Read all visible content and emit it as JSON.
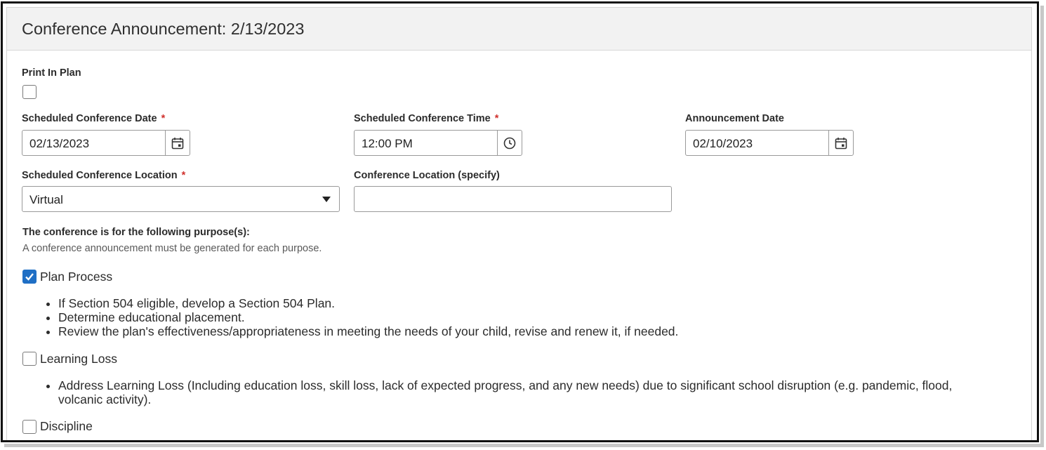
{
  "panel": {
    "title": "Conference Announcement: 2/13/2023"
  },
  "print_in_plan": {
    "label": "Print In Plan",
    "checked": false
  },
  "fields": {
    "conference_date": {
      "label": "Scheduled Conference Date",
      "required_mark": "*",
      "value": "02/13/2023",
      "button_icon": "calendar-icon"
    },
    "conference_time": {
      "label": "Scheduled Conference Time",
      "required_mark": "*",
      "value": "12:00 PM",
      "button_icon": "clock-icon"
    },
    "announcement_date": {
      "label": "Announcement Date",
      "value": "02/10/2023",
      "button_icon": "calendar-icon"
    },
    "conference_location": {
      "label": "Scheduled Conference Location",
      "required_mark": "*",
      "value": "Virtual",
      "button_icon": "dropdown-arrow-icon"
    },
    "location_specify": {
      "label": "Conference Location (specify)",
      "value": ""
    }
  },
  "purposes": {
    "heading": "The conference is for the following purpose(s):",
    "hint": "A conference announcement must be generated for each purpose.",
    "items": [
      {
        "label": "Plan Process",
        "checked": true,
        "bullets": [
          "If Section 504 eligible, develop a Section 504 Plan.",
          "Determine educational placement.",
          "Review the plan's effectiveness/appropriateness in meeting the needs of your child, revise and renew it, if needed."
        ]
      },
      {
        "label": "Learning Loss",
        "checked": false,
        "bullets": [
          "Address Learning Loss (Including education loss, skill loss, lack of expected progress, and any new needs) due to significant school disruption (e.g. pandemic, flood, volcanic activity)."
        ]
      },
      {
        "label": "Discipline",
        "checked": false,
        "bullets": []
      }
    ]
  },
  "colors": {
    "accent": "#1f6fc5",
    "required": "#d0312d",
    "header_bg": "#f2f2f2"
  }
}
